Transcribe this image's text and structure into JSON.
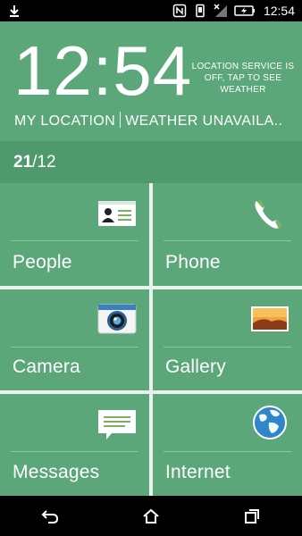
{
  "status_bar": {
    "time": "12:54",
    "icons": [
      "download-icon",
      "nfc-icon",
      "vibrate-icon",
      "no-signal-icon",
      "battery-charging-icon"
    ]
  },
  "header": {
    "clock": "12:54",
    "location_message": "LOCATION SERVICE IS OFF, TAP TO SEE WEATHER",
    "location_label": "MY LOCATION",
    "weather_label": "WEATHER UNAVAILA.."
  },
  "date": {
    "day": "21",
    "month": "/12"
  },
  "tiles": [
    {
      "label": "People",
      "icon": "contact-card-icon"
    },
    {
      "label": "Phone",
      "icon": "phone-icon"
    },
    {
      "label": "Camera",
      "icon": "camera-icon"
    },
    {
      "label": "Gallery",
      "icon": "gallery-icon"
    },
    {
      "label": "Messages",
      "icon": "message-icon"
    },
    {
      "label": "Internet",
      "icon": "globe-icon"
    }
  ],
  "nav": {
    "icons": [
      "back-icon",
      "home-icon",
      "recents-icon"
    ]
  },
  "colors": {
    "tile": "#5ba779",
    "date_bar": "#4f9a6c",
    "grid_line": "#e9f2ec"
  }
}
